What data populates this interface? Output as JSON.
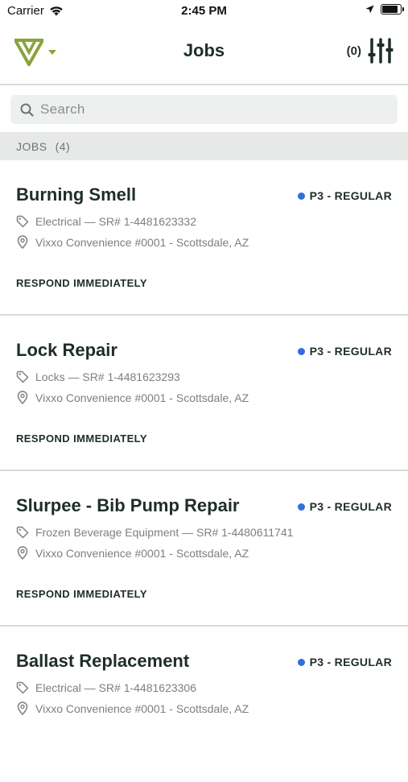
{
  "status_bar": {
    "carrier": "Carrier",
    "time": "2:45 PM"
  },
  "header": {
    "title": "Jobs",
    "filter_count": "(0)",
    "brand_color": "#8aa33c"
  },
  "search": {
    "placeholder": "Search"
  },
  "section": {
    "label": "JOBS",
    "count": "(4)"
  },
  "jobs": [
    {
      "title": "Burning Smell",
      "priority": "P3 - REGULAR",
      "category": "Electrical — SR# 1-4481623332",
      "location": "Vixxo Convenience #0001 - Scottsdale, AZ",
      "action": "RESPOND IMMEDIATELY"
    },
    {
      "title": "Lock Repair",
      "priority": "P3 - REGULAR",
      "category": "Locks — SR# 1-4481623293",
      "location": "Vixxo Convenience #0001 - Scottsdale, AZ",
      "action": "RESPOND IMMEDIATELY"
    },
    {
      "title": "Slurpee - Bib Pump Repair",
      "priority": "P3 - REGULAR",
      "category": "Frozen Beverage Equipment — SR# 1-4480611741",
      "location": "Vixxo Convenience #0001 - Scottsdale, AZ",
      "action": "RESPOND IMMEDIATELY"
    },
    {
      "title": "Ballast Replacement",
      "priority": "P3 - REGULAR",
      "category": "Electrical — SR# 1-4481623306",
      "location": "Vixxo Convenience #0001 - Scottsdale, AZ",
      "action": ""
    }
  ],
  "colors": {
    "priority_dot": "#2f6fe0",
    "divider": "#d7dbda",
    "section_bg": "#e6e9e8"
  },
  "icons": {
    "wifi": "wifi-icon",
    "location_arrow": "location-arrow-icon",
    "battery": "battery-icon",
    "logo": "vixxo-logo",
    "dropdown": "caret-down-icon",
    "filter": "sliders-icon",
    "search": "search-icon",
    "tag": "tag-icon",
    "pin": "map-pin-icon"
  }
}
